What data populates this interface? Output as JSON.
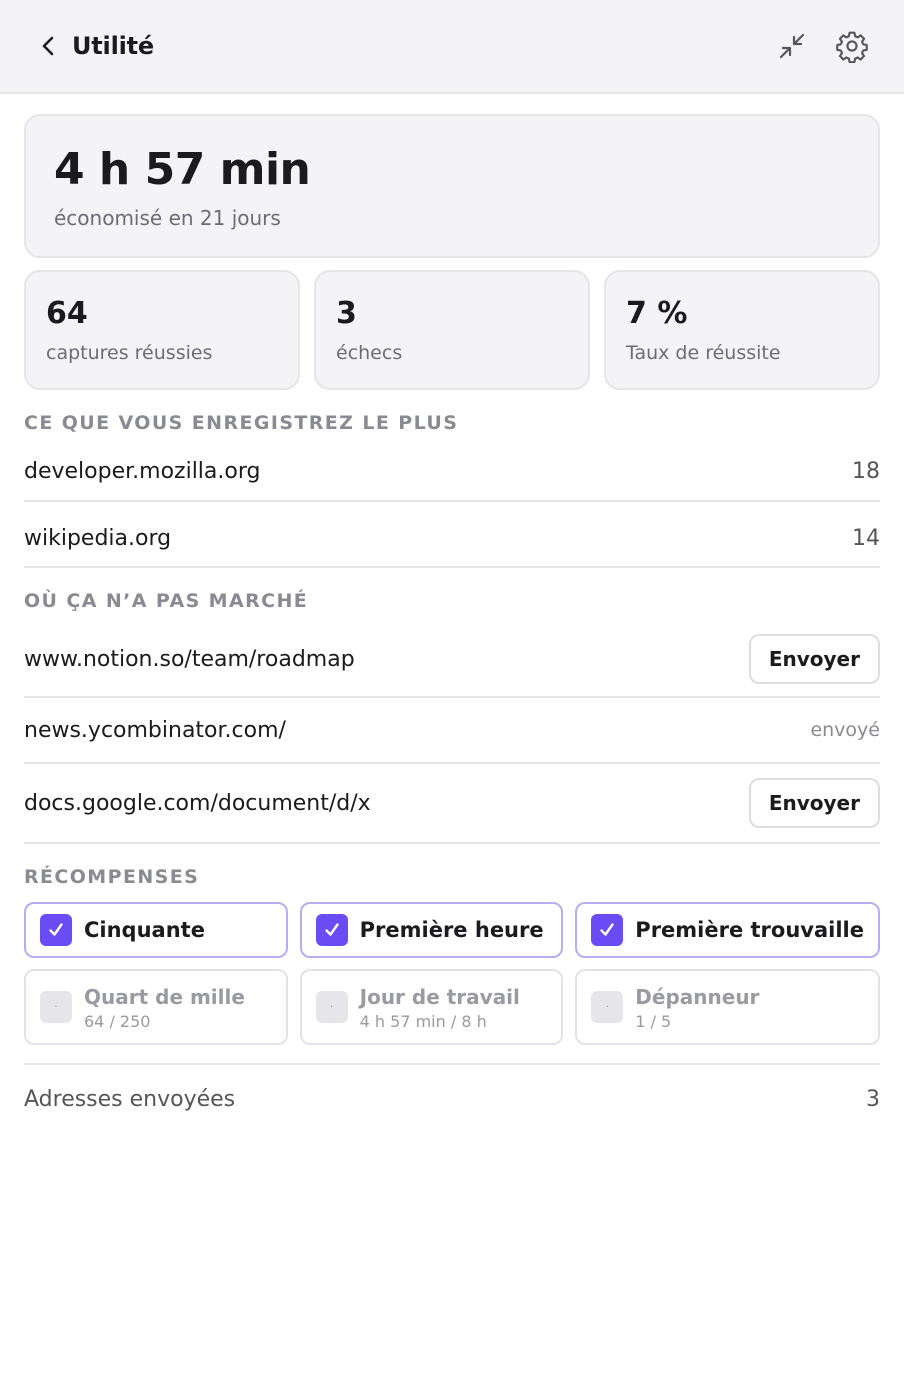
{
  "header": {
    "title": "Utilité",
    "back_icon": "chevron-left-icon",
    "collapse_icon": "minimize-icon",
    "settings_icon": "gear-icon"
  },
  "hero": {
    "value": "4 h 57 min",
    "subtitle": "économisé en 21 jours"
  },
  "stats": [
    {
      "value": "64",
      "label": "captures réussies"
    },
    {
      "value": "3",
      "label": "échecs"
    },
    {
      "value": "7 %",
      "label": "Taux de réussite"
    }
  ],
  "top_sites": {
    "title": "CE QUE VOUS ENREGISTREZ LE PLUS",
    "items": [
      {
        "domain": "developer.mozilla.org",
        "count": "18"
      },
      {
        "domain": "wikipedia.org",
        "count": "14"
      }
    ]
  },
  "failures": {
    "title": "OÙ ÇA N’A PAS MARCHÉ",
    "items": [
      {
        "url": "www.notion.so/team/roadmap",
        "action": "Envoyer"
      },
      {
        "url": "news.ycombinator.com/",
        "status": "envoyé"
      },
      {
        "url": "docs.google.com/document/d/x",
        "action": "Envoyer"
      }
    ]
  },
  "rewards": {
    "title": "RÉCOMPENSES",
    "unlocked": [
      {
        "label": "Cinquante"
      },
      {
        "label": "Première heure"
      },
      {
        "label": "Première trouvaille"
      }
    ],
    "locked": [
      {
        "label": "Quart de mille",
        "progress": "64 / 250"
      },
      {
        "label": "Jour de travail",
        "progress": "4 h 57 min / 8 h"
      },
      {
        "label": "Dépanneur",
        "progress": "1 / 5"
      }
    ],
    "lock_glyph": "·"
  },
  "footer": {
    "label": "Adresses envoyées",
    "count": "3"
  },
  "colors": {
    "accent": "#6a4cf5",
    "badge_border": "#b7adf0",
    "panel_bg": "#f4f4f6"
  }
}
